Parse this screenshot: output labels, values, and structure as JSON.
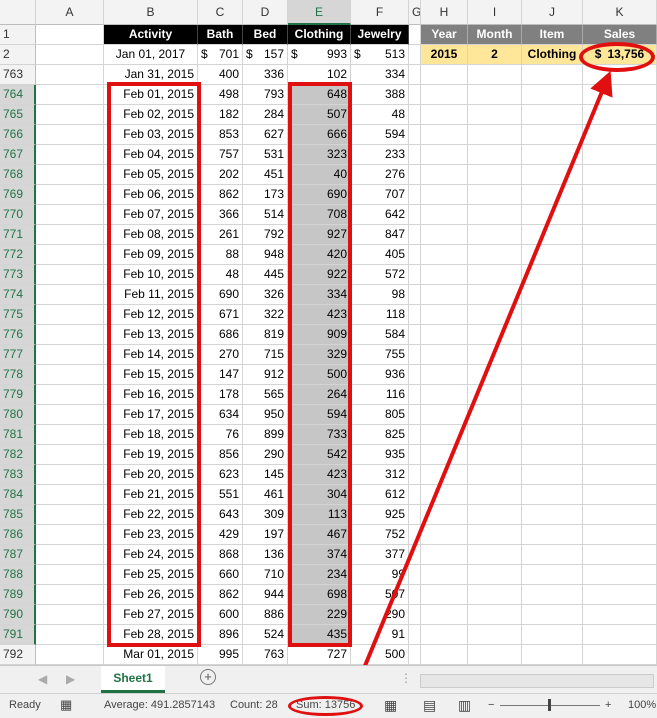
{
  "columns": [
    "",
    "A",
    "B",
    "C",
    "D",
    "E",
    "F",
    "G",
    "H",
    "I",
    "J",
    "K"
  ],
  "header_row": {
    "num": "1",
    "activity": "Activity",
    "bath": "Bath",
    "bed": "Bed",
    "clothing": "Clothing",
    "jewelry": "Jewelry",
    "year": "Year",
    "month": "Month",
    "item": "Item",
    "sales": "Sales"
  },
  "row2": {
    "num": "2",
    "activity": "Jan 01, 2017",
    "bath_sym": "$",
    "bath": "701",
    "bed_sym": "$",
    "bed": "157",
    "clothing_sym": "$",
    "clothing": "993",
    "jewelry_sym": "$",
    "jewelry": "513",
    "year": "2015",
    "month": "2",
    "item": "Clothing",
    "sales_sym": "$",
    "sales": "13,756"
  },
  "rows": [
    {
      "num": "763",
      "date": "Jan 31, 2015",
      "bath": "400",
      "bed": "336",
      "clothing": "102",
      "jewelry": "334"
    },
    {
      "num": "764",
      "date": "Feb 01, 2015",
      "bath": "498",
      "bed": "793",
      "clothing": "648",
      "jewelry": "388"
    },
    {
      "num": "765",
      "date": "Feb 02, 2015",
      "bath": "182",
      "bed": "284",
      "clothing": "507",
      "jewelry": "48"
    },
    {
      "num": "766",
      "date": "Feb 03, 2015",
      "bath": "853",
      "bed": "627",
      "clothing": "666",
      "jewelry": "594"
    },
    {
      "num": "767",
      "date": "Feb 04, 2015",
      "bath": "757",
      "bed": "531",
      "clothing": "323",
      "jewelry": "233"
    },
    {
      "num": "768",
      "date": "Feb 05, 2015",
      "bath": "202",
      "bed": "451",
      "clothing": "40",
      "jewelry": "276"
    },
    {
      "num": "769",
      "date": "Feb 06, 2015",
      "bath": "862",
      "bed": "173",
      "clothing": "690",
      "jewelry": "707"
    },
    {
      "num": "770",
      "date": "Feb 07, 2015",
      "bath": "366",
      "bed": "514",
      "clothing": "708",
      "jewelry": "642"
    },
    {
      "num": "771",
      "date": "Feb 08, 2015",
      "bath": "261",
      "bed": "792",
      "clothing": "927",
      "jewelry": "847"
    },
    {
      "num": "772",
      "date": "Feb 09, 2015",
      "bath": "88",
      "bed": "948",
      "clothing": "420",
      "jewelry": "405"
    },
    {
      "num": "773",
      "date": "Feb 10, 2015",
      "bath": "48",
      "bed": "445",
      "clothing": "922",
      "jewelry": "572"
    },
    {
      "num": "774",
      "date": "Feb 11, 2015",
      "bath": "690",
      "bed": "326",
      "clothing": "334",
      "jewelry": "98"
    },
    {
      "num": "775",
      "date": "Feb 12, 2015",
      "bath": "671",
      "bed": "322",
      "clothing": "423",
      "jewelry": "118"
    },
    {
      "num": "776",
      "date": "Feb 13, 2015",
      "bath": "686",
      "bed": "819",
      "clothing": "909",
      "jewelry": "584"
    },
    {
      "num": "777",
      "date": "Feb 14, 2015",
      "bath": "270",
      "bed": "715",
      "clothing": "329",
      "jewelry": "755"
    },
    {
      "num": "778",
      "date": "Feb 15, 2015",
      "bath": "147",
      "bed": "912",
      "clothing": "500",
      "jewelry": "936"
    },
    {
      "num": "779",
      "date": "Feb 16, 2015",
      "bath": "178",
      "bed": "565",
      "clothing": "264",
      "jewelry": "116"
    },
    {
      "num": "780",
      "date": "Feb 17, 2015",
      "bath": "634",
      "bed": "950",
      "clothing": "594",
      "jewelry": "805"
    },
    {
      "num": "781",
      "date": "Feb 18, 2015",
      "bath": "76",
      "bed": "899",
      "clothing": "733",
      "jewelry": "825"
    },
    {
      "num": "782",
      "date": "Feb 19, 2015",
      "bath": "856",
      "bed": "290",
      "clothing": "542",
      "jewelry": "935"
    },
    {
      "num": "783",
      "date": "Feb 20, 2015",
      "bath": "623",
      "bed": "145",
      "clothing": "423",
      "jewelry": "312"
    },
    {
      "num": "784",
      "date": "Feb 21, 2015",
      "bath": "551",
      "bed": "461",
      "clothing": "304",
      "jewelry": "612"
    },
    {
      "num": "785",
      "date": "Feb 22, 2015",
      "bath": "643",
      "bed": "309",
      "clothing": "113",
      "jewelry": "925"
    },
    {
      "num": "786",
      "date": "Feb 23, 2015",
      "bath": "429",
      "bed": "197",
      "clothing": "467",
      "jewelry": "752"
    },
    {
      "num": "787",
      "date": "Feb 24, 2015",
      "bath": "868",
      "bed": "136",
      "clothing": "374",
      "jewelry": "377"
    },
    {
      "num": "788",
      "date": "Feb 25, 2015",
      "bath": "660",
      "bed": "710",
      "clothing": "234",
      "jewelry": "99"
    },
    {
      "num": "789",
      "date": "Feb 26, 2015",
      "bath": "862",
      "bed": "944",
      "clothing": "698",
      "jewelry": "507"
    },
    {
      "num": "790",
      "date": "Feb 27, 2015",
      "bath": "600",
      "bed": "886",
      "clothing": "229",
      "jewelry": "290"
    },
    {
      "num": "791",
      "date": "Feb 28, 2015",
      "bath": "896",
      "bed": "524",
      "clothing": "435",
      "jewelry": "91"
    },
    {
      "num": "792",
      "date": "Mar 01, 2015",
      "bath": "995",
      "bed": "763",
      "clothing": "727",
      "jewelry": "500"
    }
  ],
  "sheet_tab": "Sheet1",
  "status": {
    "ready": "Ready",
    "average": "Average: 491.2857143",
    "count": "Count: 28",
    "sum": "Sum: 13756",
    "zoom": "100%"
  },
  "colors": {
    "accent": "#217346",
    "highlight_red": "#e01010",
    "sales_fill": "#ffe699",
    "selection": "#c6c6c6"
  }
}
